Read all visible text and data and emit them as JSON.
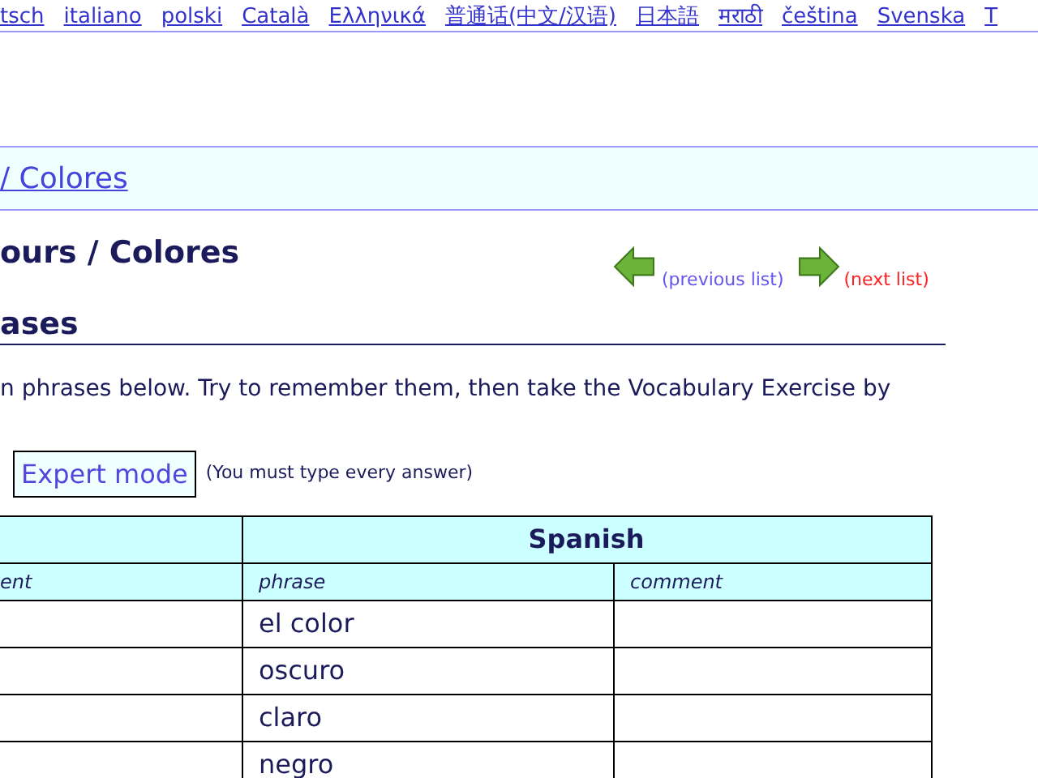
{
  "languages": [
    {
      "label": "tsch"
    },
    {
      "label": "italiano"
    },
    {
      "label": "polski"
    },
    {
      "label": "Català"
    },
    {
      "label": "Ελληνικά"
    },
    {
      "label": "普通话(中文/汉语)"
    },
    {
      "label": "日本語"
    },
    {
      "label": "मराठी"
    },
    {
      "label": "čeština"
    },
    {
      "label": "Svenska"
    },
    {
      "label": "T"
    }
  ],
  "breadcrumb": "/  Colores",
  "title": "ours / Colores",
  "nav": {
    "previous": "(previous list)",
    "next": "(next list)"
  },
  "section_heading": "ases",
  "intro": "n phrases below. Try to remember them, then take the Vocabulary Exercise by",
  "expert_button": "Expert mode",
  "expert_note": "(You must type every answer)",
  "table": {
    "group_header": "Spanish",
    "columns": [
      "ent",
      "phrase",
      "comment"
    ],
    "rows": [
      {
        "phrase": "el color"
      },
      {
        "phrase": "oscuro"
      },
      {
        "phrase": "claro"
      },
      {
        "phrase": "negro"
      }
    ]
  }
}
